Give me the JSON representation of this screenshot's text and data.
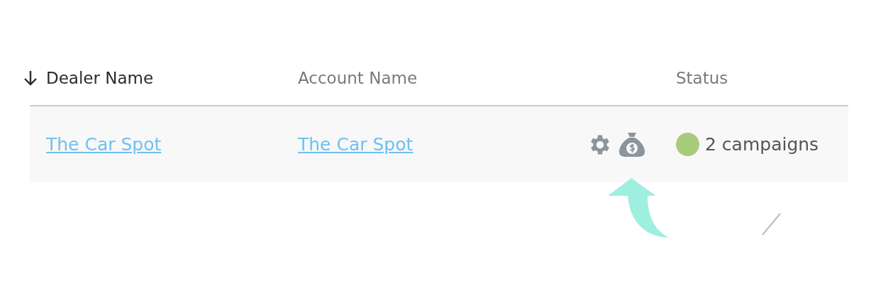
{
  "table": {
    "columns": [
      {
        "label": "Dealer Name",
        "sorted": true
      },
      {
        "label": "Account Name",
        "sorted": false
      },
      {
        "label": "Status",
        "sorted": false
      }
    ],
    "rows": [
      {
        "dealer_name": "The Car Spot",
        "account_name": "The Car Spot",
        "status": {
          "color": "#a8cc7c",
          "text": "2 campaigns"
        }
      }
    ]
  }
}
